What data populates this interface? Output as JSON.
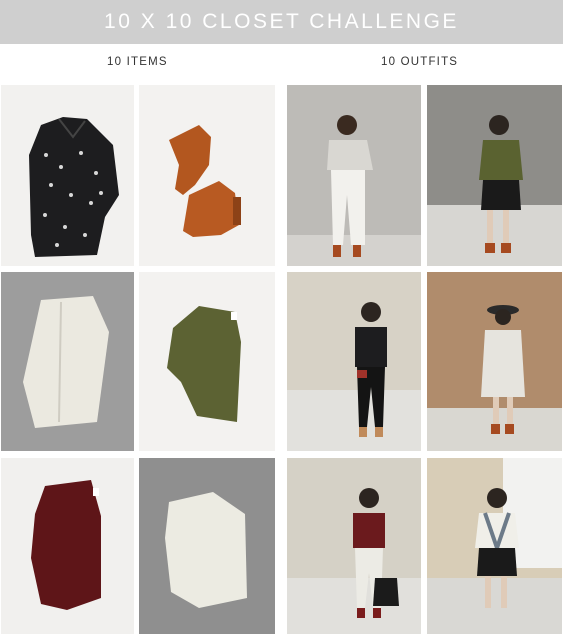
{
  "header": {
    "title": "10 X 10 CLOSET CHALLENGE"
  },
  "columns": {
    "items_label": "10 ITEMS",
    "outfits_label": "10 OUTFITS"
  },
  "colors": {
    "banner": "#cfcfcf",
    "white_bg": "#f0efed",
    "gray_bg": "#9c9c9c"
  },
  "grid": {
    "items": [
      {
        "name": "black-print-shirt",
        "icon": "shirt-icon"
      },
      {
        "name": "tan-ankle-boots",
        "icon": "boot-icon"
      },
      {
        "name": "white-trousers",
        "icon": "pants-icon"
      },
      {
        "name": "olive-top",
        "icon": "top-icon"
      },
      {
        "name": "burgundy-sweater",
        "icon": "sweater-icon"
      },
      {
        "name": "cream-top",
        "icon": "top-icon"
      }
    ],
    "outfits": [
      {
        "name": "outfit-1",
        "icon": "person-icon"
      },
      {
        "name": "outfit-2",
        "icon": "person-icon"
      },
      {
        "name": "outfit-3",
        "icon": "person-icon"
      },
      {
        "name": "outfit-4",
        "icon": "person-icon"
      },
      {
        "name": "outfit-5",
        "icon": "person-icon"
      },
      {
        "name": "outfit-6",
        "icon": "person-icon"
      }
    ]
  }
}
